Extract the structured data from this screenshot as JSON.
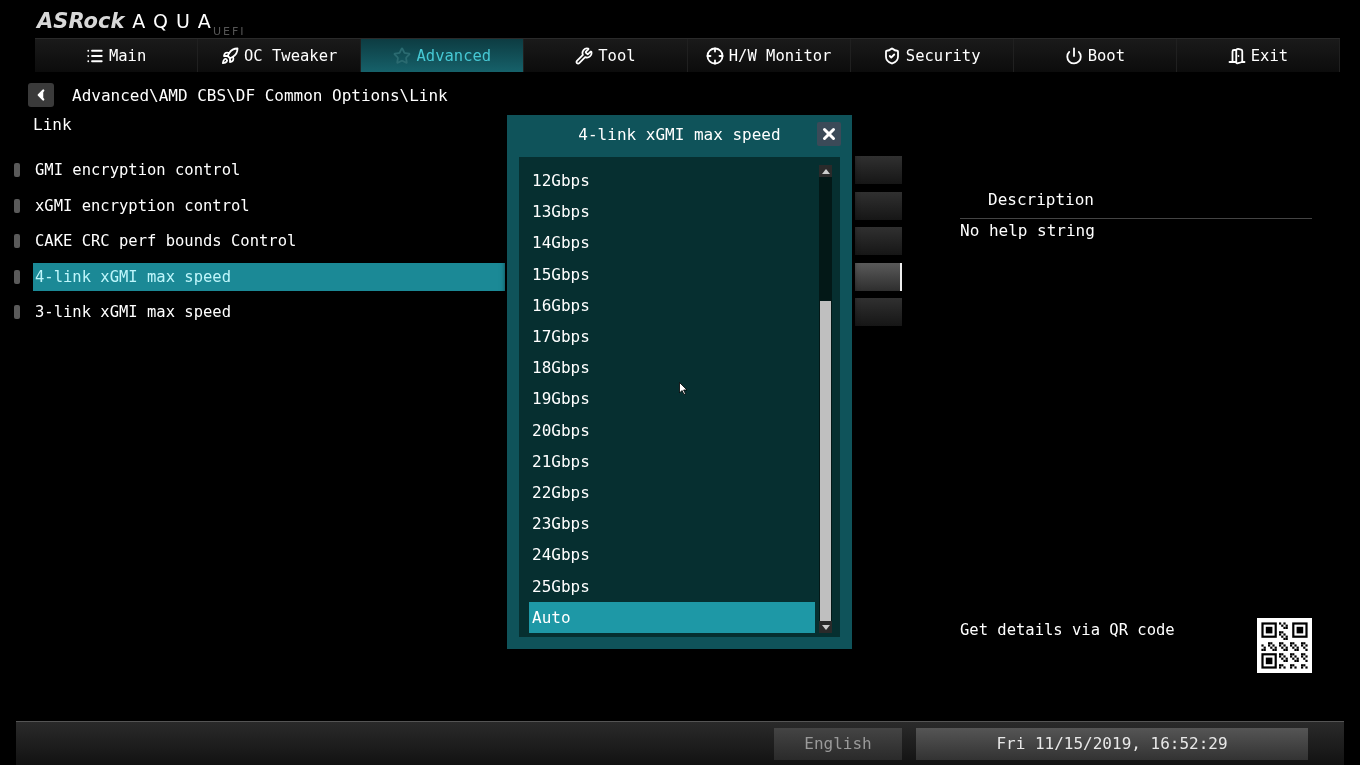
{
  "logo": {
    "brand": "ASRock",
    "product": "AQUA",
    "edition": "UEFI"
  },
  "tabs": [
    {
      "label": "Main",
      "selected": false
    },
    {
      "label": "OC Tweaker",
      "selected": false
    },
    {
      "label": "Advanced",
      "selected": true
    },
    {
      "label": "Tool",
      "selected": false
    },
    {
      "label": "H/W Monitor",
      "selected": false
    },
    {
      "label": "Security",
      "selected": false
    },
    {
      "label": "Boot",
      "selected": false
    },
    {
      "label": "Exit",
      "selected": false
    }
  ],
  "breadcrumb": "Advanced\\AMD CBS\\DF Common Options\\Link",
  "page_title": "Link",
  "settings": [
    {
      "label": "GMI encryption control",
      "selected": false
    },
    {
      "label": "xGMI encryption control",
      "selected": false
    },
    {
      "label": "CAKE CRC perf bounds Control",
      "selected": false
    },
    {
      "label": "4-link xGMI max speed",
      "selected": true
    },
    {
      "label": "3-link xGMI max speed",
      "selected": false
    }
  ],
  "dialog": {
    "title": "4-link xGMI max speed",
    "options": [
      {
        "label": "12Gbps",
        "selected": false
      },
      {
        "label": "13Gbps",
        "selected": false
      },
      {
        "label": "14Gbps",
        "selected": false
      },
      {
        "label": "15Gbps",
        "selected": false
      },
      {
        "label": "16Gbps",
        "selected": false
      },
      {
        "label": "17Gbps",
        "selected": false
      },
      {
        "label": "18Gbps",
        "selected": false
      },
      {
        "label": "19Gbps",
        "selected": false
      },
      {
        "label": "20Gbps",
        "selected": false
      },
      {
        "label": "21Gbps",
        "selected": false
      },
      {
        "label": "22Gbps",
        "selected": false
      },
      {
        "label": "23Gbps",
        "selected": false
      },
      {
        "label": "24Gbps",
        "selected": false
      },
      {
        "label": "25Gbps",
        "selected": false
      },
      {
        "label": "Auto",
        "selected": true
      }
    ]
  },
  "description": {
    "heading": "Description",
    "text": "No help string"
  },
  "qr": {
    "caption": "Get details via QR code"
  },
  "status_bar": {
    "language": "English",
    "datetime": "Fri 11/15/2019, 16:52:29"
  }
}
